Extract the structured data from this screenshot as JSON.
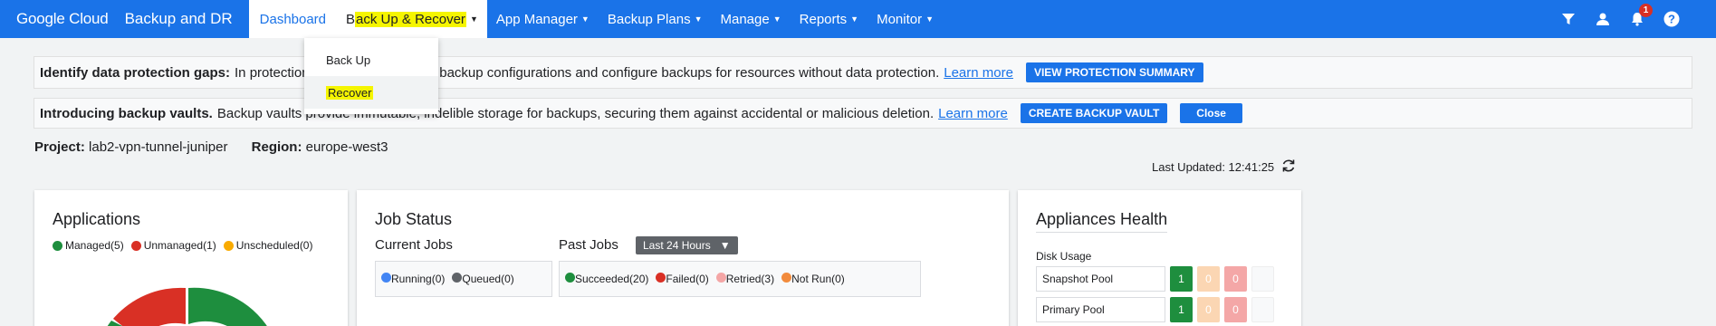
{
  "header": {
    "brand": "Google Cloud",
    "product": "Backup and DR",
    "nav": [
      {
        "label": "Dashboard"
      },
      {
        "label_pre": "B",
        "label_hl": "ack Up & Recover"
      },
      {
        "label": "App Manager"
      },
      {
        "label": "Backup Plans"
      },
      {
        "label": "Manage"
      },
      {
        "label": "Reports"
      },
      {
        "label": "Monitor"
      }
    ],
    "notification_count": "1",
    "icons": [
      "filter-icon",
      "user-icon",
      "bell-icon",
      "help-icon"
    ]
  },
  "dropdown": {
    "items": [
      {
        "label": "Back Up"
      },
      {
        "label": "Recover"
      }
    ]
  },
  "banners": {
    "gaps": {
      "title": "Identify data protection gaps:",
      "text_start": "In protection s",
      "text_end": "backup configurations and configure backups for resources without data protection.",
      "link": "Learn more",
      "button": "VIEW PROTECTION SUMMARY"
    },
    "vaults": {
      "title": "Introducing backup vaults.",
      "text": "Backup vaults provide immutable, indelible storage for backups, securing them against accidental or malicious deletion.",
      "link": "Learn more",
      "button": "CREATE BACKUP VAULT",
      "close": "Close"
    }
  },
  "project": {
    "project_label": "Project:",
    "project_value": "lab2-vpn-tunnel-juniper",
    "region_label": "Region:",
    "region_value": "europe-west3"
  },
  "last_updated": "Last Updated: 12:41:25",
  "applications": {
    "title": "Applications",
    "legend": [
      {
        "label": "Managed(5)",
        "color": "#1e8e3e"
      },
      {
        "label": "Unmanaged(1)",
        "color": "#d93025"
      },
      {
        "label": "Unscheduled(0)",
        "color": "#f9ab00"
      }
    ]
  },
  "job_status": {
    "title": "Job Status",
    "current_label": "Current Jobs",
    "past_label": "Past Jobs",
    "range": "Last 24 Hours",
    "current": [
      {
        "label": "Running(0)",
        "color": "#4285f4"
      },
      {
        "label": "Queued(0)",
        "color": "#5f6368"
      }
    ],
    "past": [
      {
        "label": "Succeeded(20)",
        "color": "#1e8e3e"
      },
      {
        "label": "Failed(0)",
        "color": "#d93025"
      },
      {
        "label": "Retried(3)",
        "color": "#f4a6a6"
      },
      {
        "label": "Not Run(0)",
        "color": "#f28b3c"
      }
    ]
  },
  "appliances": {
    "title": "Appliances Health",
    "disk_usage": "Disk Usage",
    "pools": [
      {
        "name": "Snapshot Pool",
        "counts": [
          "1",
          "0",
          "0"
        ]
      },
      {
        "name": "Primary Pool",
        "counts": [
          "1",
          "0",
          "0"
        ]
      }
    ],
    "colors": [
      "#1e8e3e",
      "#fbd6b3",
      "#f4a7a7",
      "#f8f9fa"
    ]
  }
}
